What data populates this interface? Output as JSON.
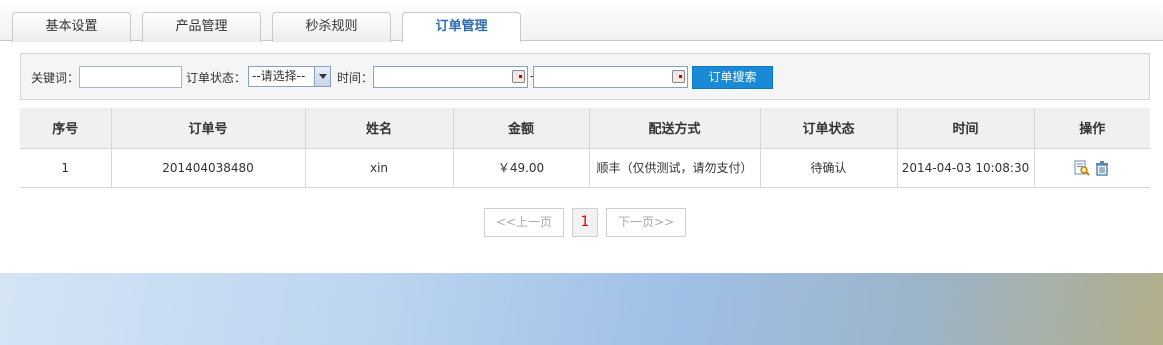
{
  "tabs": [
    {
      "label": "基本设置"
    },
    {
      "label": "产品管理"
    },
    {
      "label": "秒杀规则"
    },
    {
      "label": "订单管理"
    }
  ],
  "search": {
    "keyword_label": "关键词：",
    "keyword_value": "",
    "status_label": "订单状态：",
    "status_selected": "--请选择--",
    "time_label": "时间：",
    "date_from": "",
    "date_to": "",
    "range_sep": "-",
    "button_label": "订单搜索"
  },
  "table": {
    "headers": [
      "序号",
      "订单号",
      "姓名",
      "金额",
      "配送方式",
      "订单状态",
      "时间",
      "操作"
    ],
    "rows": [
      {
        "index": "1",
        "order_no": "201404038480",
        "name": "xin",
        "amount": "￥49.00",
        "delivery": "顺丰（仅供测试，请勿支付）",
        "status": "待确认",
        "time": "2014-04-03 10:08:30"
      }
    ]
  },
  "icons": [
    "view-detail-icon",
    "delete-icon"
  ],
  "pagination": {
    "prev": "<<上一页",
    "current": "1",
    "next": "下一页>>"
  },
  "colors": {
    "accent": "#1a8ad6",
    "active_tab": "#2b6cb0",
    "current_page": "#dd0000"
  }
}
